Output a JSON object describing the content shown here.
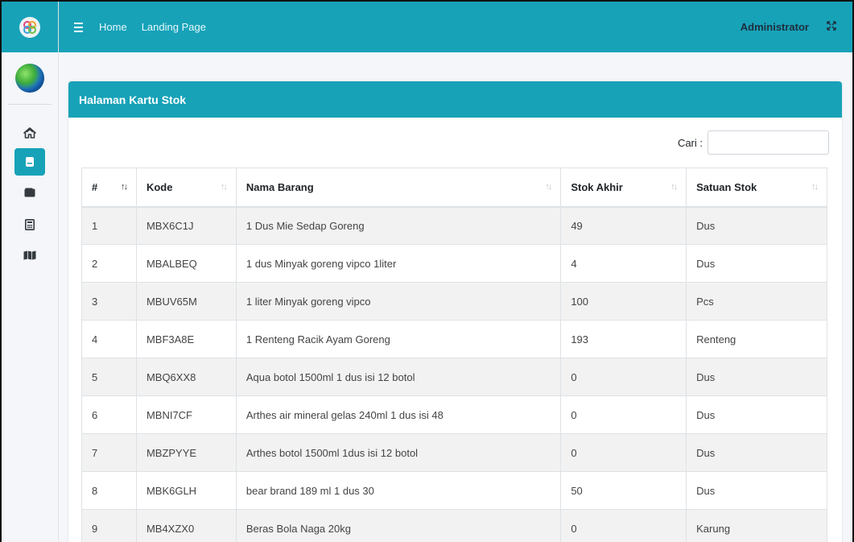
{
  "topbar": {
    "nav_home": "Home",
    "nav_landing": "Landing Page",
    "user": "Administrator"
  },
  "sidebar": {
    "items": [
      {
        "icon": "home-icon"
      },
      {
        "icon": "book-icon",
        "active": true
      },
      {
        "icon": "wallet-icon"
      },
      {
        "icon": "calculator-icon"
      },
      {
        "icon": "map-icon"
      }
    ]
  },
  "card": {
    "title": "Halaman Kartu Stok",
    "search_label": "Cari :",
    "search_value": ""
  },
  "table": {
    "headers": [
      "#",
      "Kode",
      "Nama Barang",
      "Stok Akhir",
      "Satuan Stok"
    ],
    "rows": [
      [
        "1",
        "MBX6C1J",
        "1 Dus Mie Sedap Goreng",
        "49",
        "Dus"
      ],
      [
        "2",
        "MBALBEQ",
        "1 dus Minyak goreng vipco 1liter",
        "4",
        "Dus"
      ],
      [
        "3",
        "MBUV65M",
        "1 liter Minyak goreng vipco",
        "100",
        "Pcs"
      ],
      [
        "4",
        "MBF3A8E",
        "1 Renteng Racik Ayam Goreng",
        "193",
        "Renteng"
      ],
      [
        "5",
        "MBQ6XX8",
        "Aqua botol 1500ml 1 dus isi 12 botol",
        "0",
        "Dus"
      ],
      [
        "6",
        "MBNI7CF",
        "Arthes air mineral gelas 240ml 1 dus isi 48",
        "0",
        "Dus"
      ],
      [
        "7",
        "MBZPYYE",
        "Arthes botol 1500ml 1dus isi 12 botol",
        "0",
        "Dus"
      ],
      [
        "8",
        "MBK6GLH",
        "bear brand 189 ml 1 dus 30",
        "50",
        "Dus"
      ],
      [
        "9",
        "MB4XZX0",
        "Beras Bola Naga 20kg",
        "0",
        "Karung"
      ]
    ]
  },
  "colors": {
    "accent": "#17a2b8",
    "sidebar_bg": "#f4f6f9",
    "row_stripe": "#f2f2f2"
  }
}
